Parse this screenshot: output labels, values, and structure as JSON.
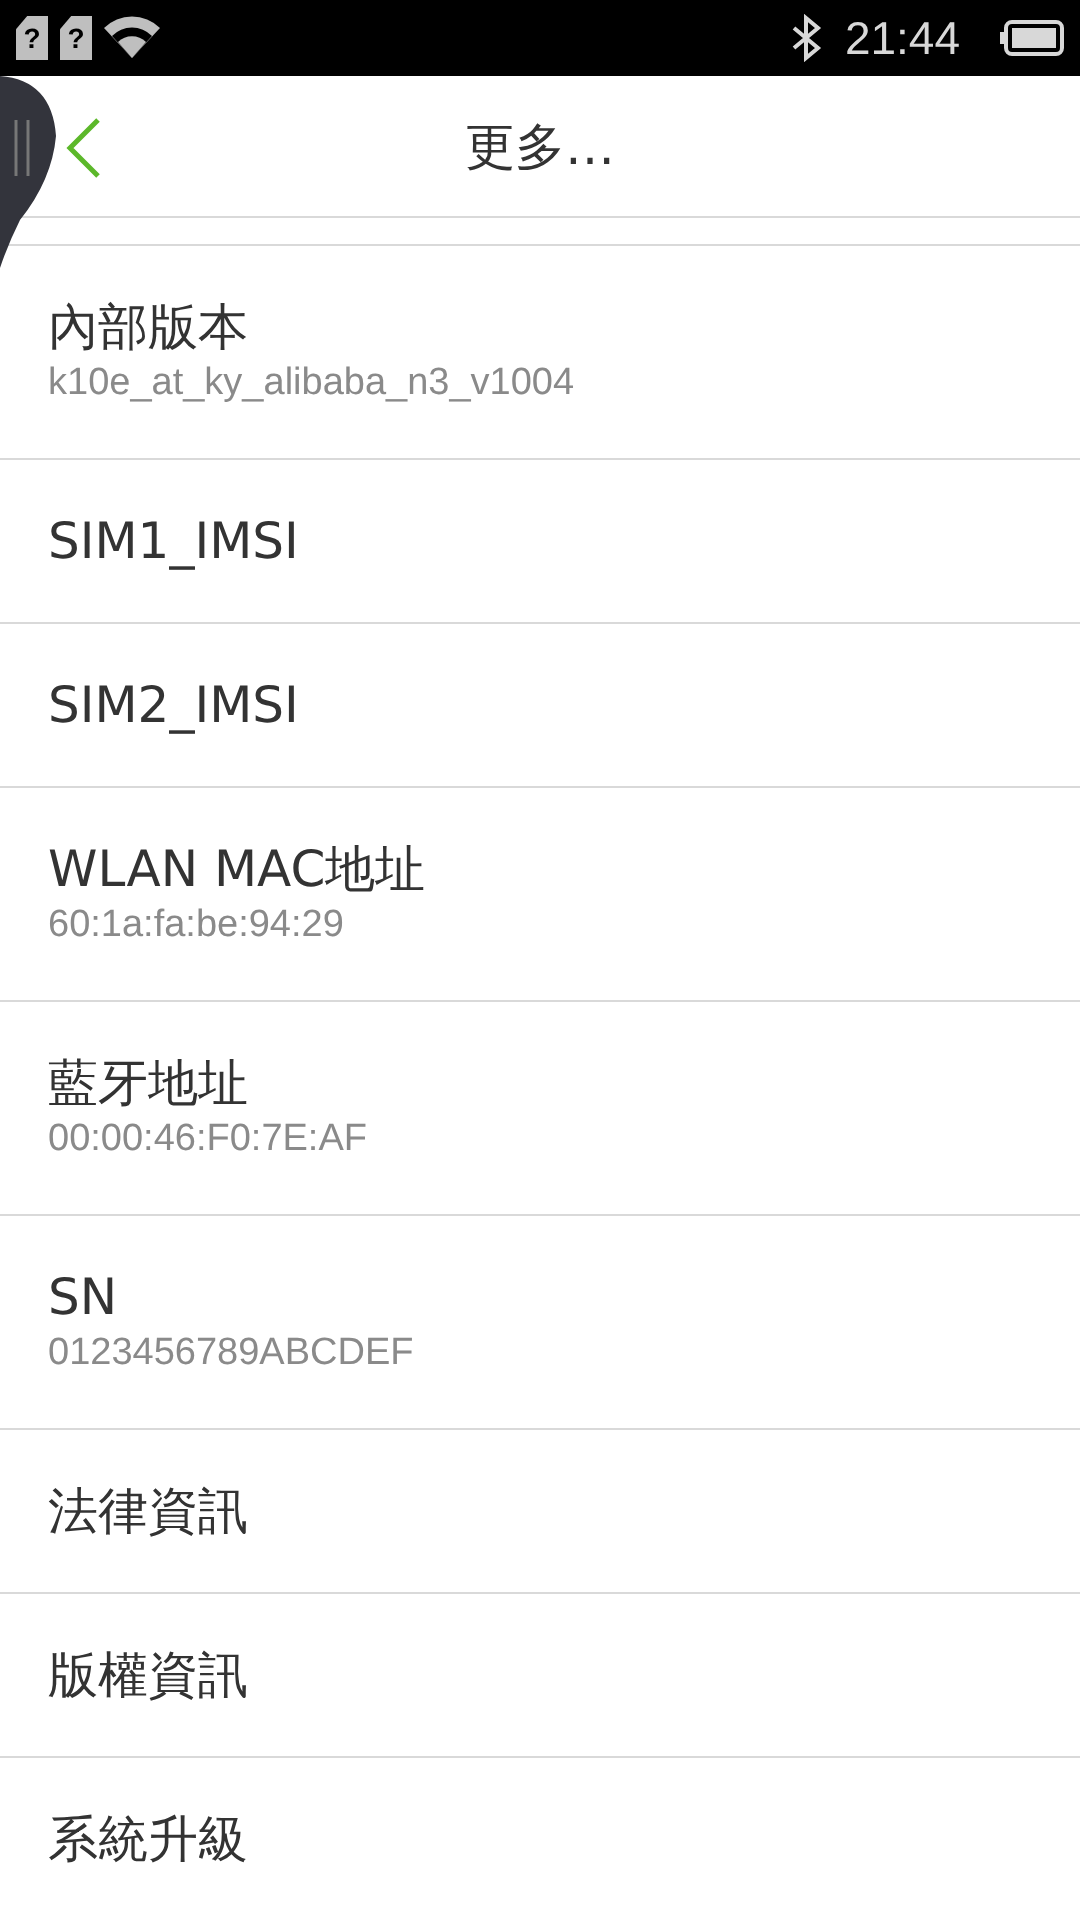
{
  "status_bar": {
    "sim_marks": [
      "?",
      "?"
    ],
    "time": "21:44"
  },
  "header": {
    "title": "更多…"
  },
  "items": [
    {
      "title": "內部版本",
      "subtitle": "k10e_at_ky_alibaba_n3_v1004"
    },
    {
      "title": "SIM1_IMSI"
    },
    {
      "title": "SIM2_IMSI"
    },
    {
      "title": "WLAN MAC地址",
      "subtitle": "60:1a:fa:be:94:29"
    },
    {
      "title": "藍牙地址",
      "subtitle": "00:00:46:F0:7E:AF"
    },
    {
      "title": "SN",
      "subtitle": "0123456789ABCDEF"
    },
    {
      "title": "法律資訊"
    },
    {
      "title": "版權資訊"
    },
    {
      "title": "系統升級"
    }
  ]
}
